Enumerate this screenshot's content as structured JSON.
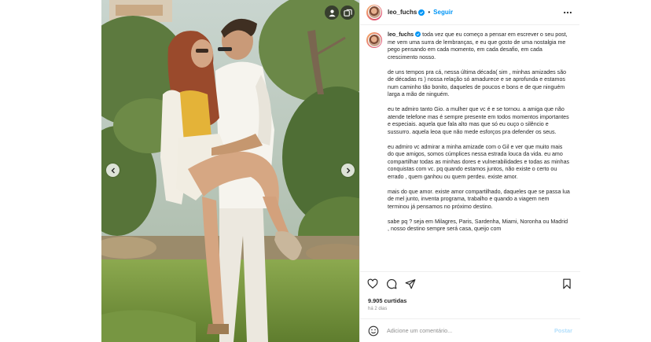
{
  "post": {
    "username": "leo_fuchs",
    "separator": "•",
    "follow_label": "Seguir",
    "caption": {
      "username": "leo_fuchs",
      "paragraphs": [
        "toda vez que eu começo a pensar em escrever o seu post, me vem uma surra de lembranças, e eu que gosto de uma nostalgia me pego pensando em cada momento, em cada desafio, em cada crescimento nosso.",
        "de uns tempos pra cá, nessa última década( sim , minhas amizades são de décadas rs ) nossa relação só amadurece e se aprofunda e estamos num caminho tão bonito, daqueles de poucos e bons e de que ninguém larga a mão de ninguém.",
        "eu te admiro tanto Gio. a mulher que vc é e se tornou. a amiga que não atende telefone mas é sempre presente em todos momentos importantes e especiais. aquela que fala alto mas que só eu ouço o silêncio e sussurro. aquela leoa que não mede esforços pra defender os seus.",
        "eu admiro vc admirar a minha amizade com o Gil e ver que muito mais do que amigos, somos cúmplices nessa estrada louca da vida. eu amo compartilhar todas as minhas dores e vulnerabilidades e todas as minhas conquistas com vc. pq quando estamos juntos, não existe o certo ou errado , quem ganhou ou quem perdeu. existe amor.",
        "mais do que amor. existe amor compartilhado, daqueles que se passa lua de mel junto, inventa programa, trabalho e quando a viagem nem terminou já pensamos no próximo destino.",
        "sabe pq ? seja em Milagres, Paris, Sardenha, Miami, Noronha ou Madrid , nosso destino sempre será casa, queijo com"
      ]
    },
    "likes": "9.905 curtidas",
    "time_ago": "há 2 dias",
    "comment_placeholder": "Adicione um comentário...",
    "post_button": "Postar"
  },
  "colors": {
    "accent": "#0095f6",
    "post_button_disabled": "#b2dffc",
    "muted_text": "#8e8e8e",
    "border": "#efefef"
  },
  "icons": [
    "verified-badge-icon",
    "more-options-icon",
    "like-heart-icon",
    "comment-icon",
    "share-icon",
    "bookmark-icon",
    "emoji-icon",
    "user-tags-icon",
    "carousel-icon",
    "carousel-prev-icon",
    "carousel-next-icon"
  ]
}
